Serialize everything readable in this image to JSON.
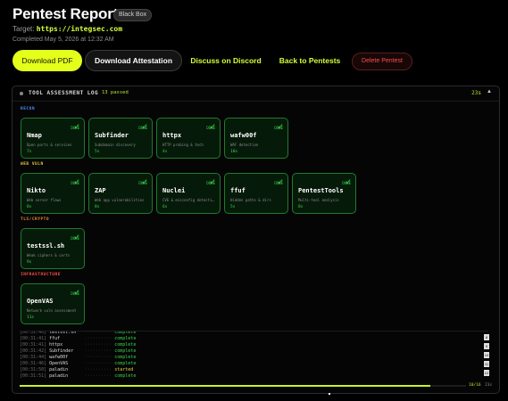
{
  "header": {
    "title": "Pentest Report",
    "badge": "Black Box",
    "target_label": "Target:",
    "target_url": "https://integsec.com",
    "completed": "Completed May 5, 2026 at 12:32 AM"
  },
  "actions": {
    "download_pdf": "Download PDF",
    "download_attestation": "Download Attestation",
    "discuss": "Discuss on Discord",
    "back": "Back to Pentests",
    "delete": "Delete Pentest"
  },
  "log_panel": {
    "title": "TOOL ASSESSMENT LOG",
    "passed": "13 passed",
    "elapsed": "23s",
    "toggle": "▲",
    "sections": [
      {
        "label": "RECON",
        "color": "#4a8cff",
        "tools": [
          {
            "name": "Nmap",
            "desc": "Open ports & services",
            "dur": "7s",
            "status": "DONE"
          },
          {
            "name": "Subfinder",
            "desc": "Subdomain discovery",
            "dur": "5s",
            "status": "DONE"
          },
          {
            "name": "httpx",
            "desc": "HTTP probing & tech",
            "dur": "4s",
            "status": "DONE"
          },
          {
            "name": "wafw00f",
            "desc": "WAF detection",
            "dur": "10s",
            "status": "DONE"
          }
        ]
      },
      {
        "label": "WEB VULN",
        "color": "#e5c63a",
        "tools": [
          {
            "name": "Nikto",
            "desc": "Web server flaws",
            "dur": "8s",
            "status": "DONE"
          },
          {
            "name": "ZAP",
            "desc": "Web app vulnerabilities",
            "dur": "8s",
            "status": "DONE"
          },
          {
            "name": "Nuclei",
            "desc": "CVE & misconfig detecti…",
            "dur": "6s",
            "status": "DONE"
          },
          {
            "name": "ffuf",
            "desc": "Hidden paths & dirs",
            "dur": "5s",
            "status": "DONE"
          },
          {
            "name": "PentestTools",
            "desc": "Multi-tool analysis",
            "dur": "8s",
            "status": "DONE"
          }
        ]
      },
      {
        "label": "TLS/CRYPTO",
        "color": "#e58a3a",
        "tools": [
          {
            "name": "testssl.sh",
            "desc": "Weak ciphers & certs",
            "dur": "9s",
            "status": "DONE"
          }
        ]
      },
      {
        "label": "INFRASTRUCTURE",
        "color": "#ff4d4d",
        "tools": [
          {
            "name": "OpenVAS",
            "desc": "Network vuln assessment",
            "dur": "11s",
            "status": "DONE"
          }
        ]
      }
    ],
    "log_lines": [
      {
        "ts": "[00:31:40]",
        "tool": "testssl.sh",
        "status": "complete",
        "kind": "complete"
      },
      {
        "ts": "[00:31:41]",
        "tool": "ffuf",
        "status": "complete",
        "kind": "complete"
      },
      {
        "ts": "[00:31:41]",
        "tool": "httpx",
        "status": "complete",
        "kind": "complete"
      },
      {
        "ts": "[00:31:42]",
        "tool": "Subfinder",
        "status": "complete",
        "kind": "complete"
      },
      {
        "ts": "[00:31:44]",
        "tool": "wafw00f",
        "status": "complete",
        "kind": "complete"
      },
      {
        "ts": "[00:31:46]",
        "tool": "OpenVAS",
        "status": "complete",
        "kind": "complete"
      },
      {
        "ts": "[00:31:50]",
        "tool": "paladin",
        "status": "started",
        "kind": "started"
      },
      {
        "ts": "[00:31:51]",
        "tool": "paladin",
        "status": "complete",
        "kind": "complete"
      }
    ],
    "scroll_marks": [
      "8",
      "9",
      "10",
      "11",
      "12"
    ],
    "progress_count": "10/16",
    "progress_fraction": 0.92,
    "progress_time": "23s"
  },
  "colors": {
    "accent": "#e4ff1a",
    "success": "#36d84a",
    "danger": "#ff4d4d"
  }
}
